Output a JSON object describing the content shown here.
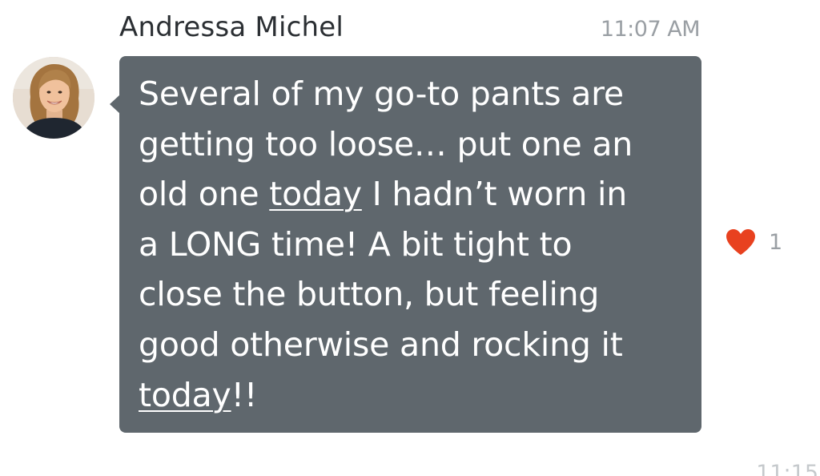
{
  "message": {
    "sender": "Andressa Michel",
    "time": "11:07 AM",
    "avatar_icon": "profile-photo",
    "text_lines": [
      {
        "pre": "Several of my go-to pants are",
        "u": "",
        "post": ""
      },
      {
        "pre": "getting too loose… put one an",
        "u": "",
        "post": ""
      },
      {
        "pre": "old one ",
        "u": "today",
        "post": " I hadn’t worn in"
      },
      {
        "pre": "a LONG time!  A bit tight to",
        "u": "",
        "post": ""
      },
      {
        "pre": "close the button, but feeling",
        "u": "",
        "post": ""
      },
      {
        "pre": "good otherwise and rocking it",
        "u": "",
        "post": ""
      },
      {
        "pre": "",
        "u": "today",
        "post": "!!"
      }
    ],
    "bubble_color": "#5f676d",
    "reaction": {
      "icon": "heart-icon",
      "color": "#e8411f",
      "count": "1"
    }
  },
  "next_message": {
    "time_partial": "11:15"
  }
}
